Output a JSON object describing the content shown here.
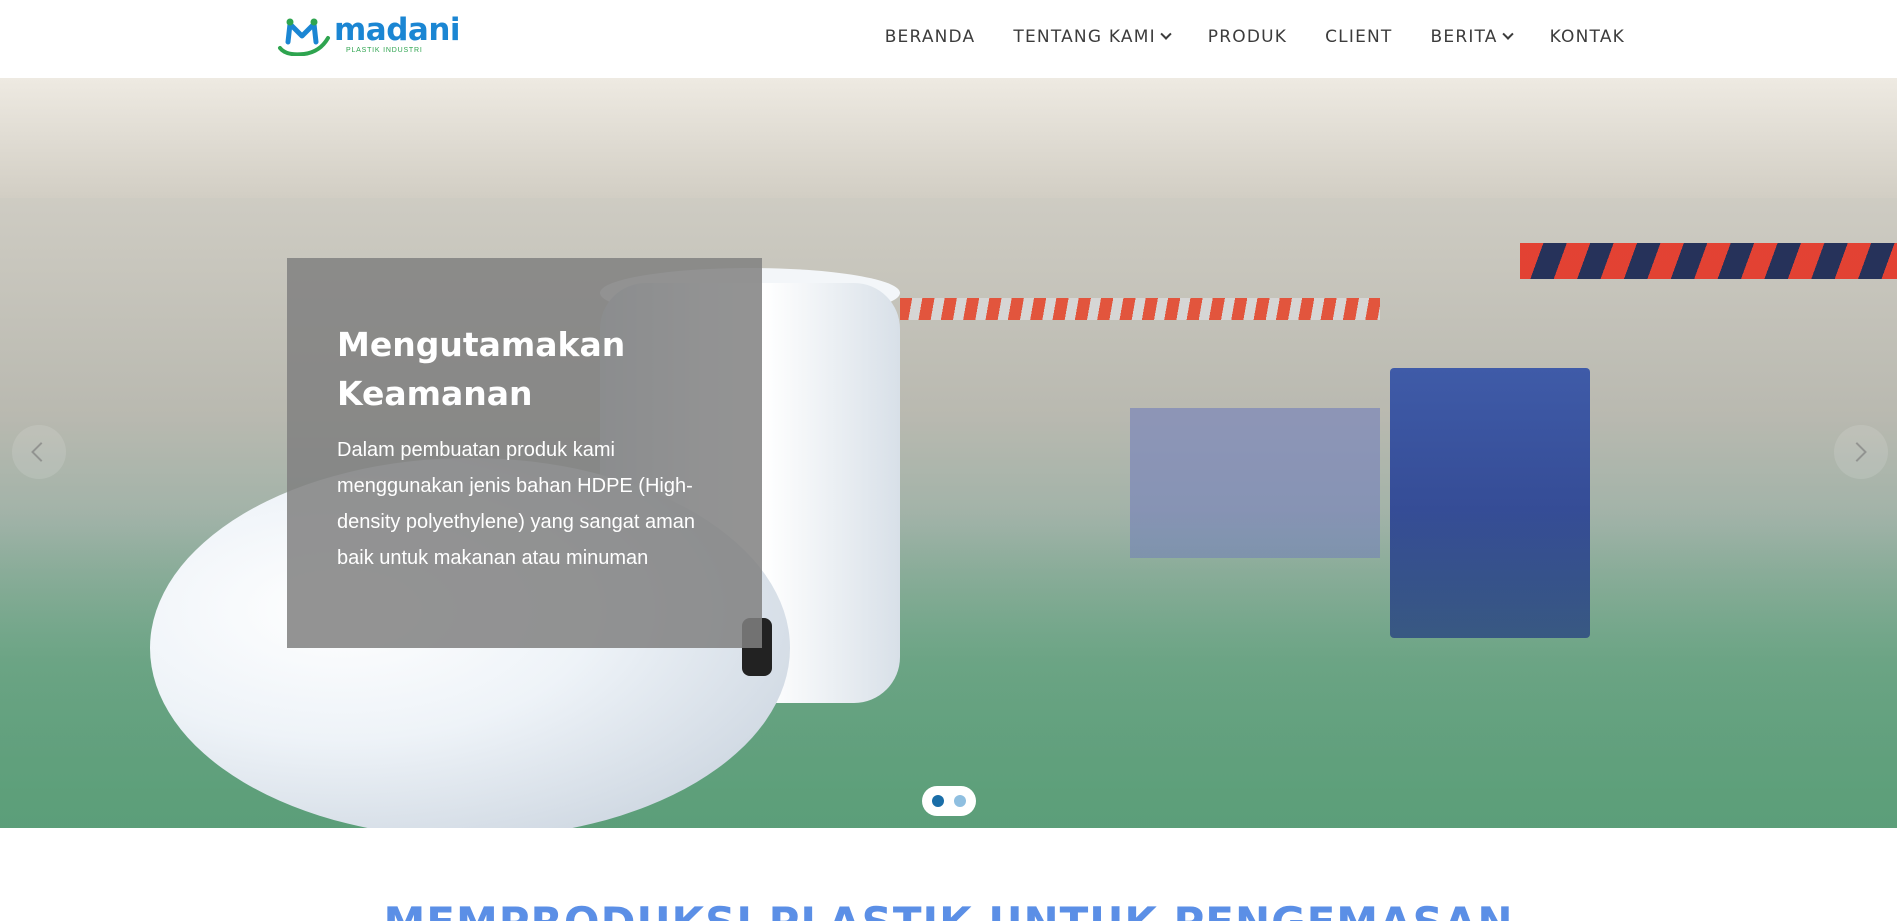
{
  "brand": {
    "name": "madani",
    "tagline": "PLASTIK INDUSTRI"
  },
  "nav": {
    "items": [
      {
        "label": "BERANDA",
        "has_dropdown": false
      },
      {
        "label": "TENTANG KAMI",
        "has_dropdown": true
      },
      {
        "label": "PRODUK",
        "has_dropdown": false
      },
      {
        "label": "CLIENT",
        "has_dropdown": false
      },
      {
        "label": "BERITA",
        "has_dropdown": true
      },
      {
        "label": "KONTAK",
        "has_dropdown": false
      }
    ]
  },
  "hero": {
    "title": "Mengutamakan Keamanan",
    "description": "Dalam pembuatan produk kami menggunakan jenis bahan HDPE (High-density polyethylene) yang sangat aman baik untuk makanan atau minuman",
    "slides_total": 2,
    "active_slide": 1
  },
  "section": {
    "title": "MEMPRODUKSI PLASTIK UNTUK PENGEMASAN"
  },
  "colors": {
    "brand_blue": "#1b86d3",
    "brand_green": "#2ea44f",
    "heading_blue": "#5b8fe6"
  }
}
